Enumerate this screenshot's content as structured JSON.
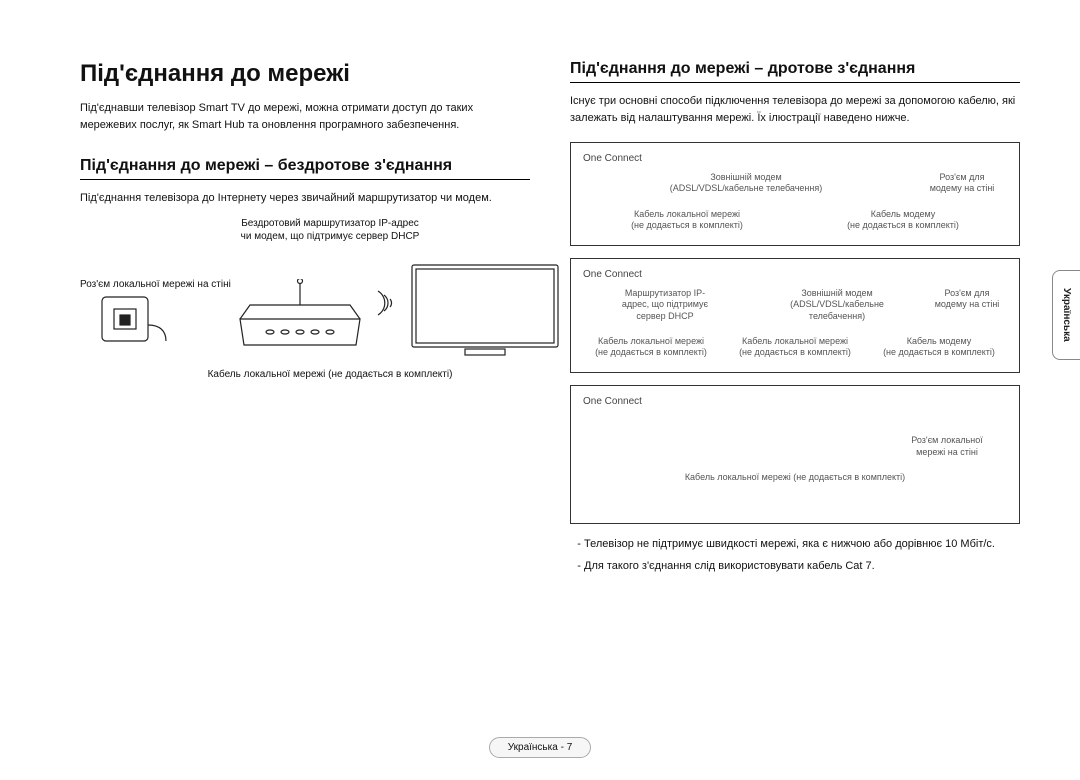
{
  "left": {
    "title": "Під'єднання до мережі",
    "intro": "Під'єднавши телевізор Smart TV до мережі, можна отримати доступ до таких мережевих послуг, як Smart Hub та оновлення програмного забезпечення.",
    "wireless_heading": "Під'єднання до мережі – бездротове з'єднання",
    "wireless_sub": "Під'єднання телевізора до Інтернету через звичайний маршрутизатор чи модем.",
    "router_caption_l1": "Бездротовий маршрутизатор IP-адрес",
    "router_caption_l2": "чи модем, що підтримує сервер DHCP",
    "wall_caption": "Роз'єм локальної мережі на стіні",
    "lan_caption": "Кабель локальної мережі (не додається в комплекті)"
  },
  "right": {
    "wired_heading": "Під'єднання до мережі – дротове з'єднання",
    "wired_sub": "Існує три основні способи підключення телевізора до мережі за допомогою кабелю, які залежать від налаштування мережі. Їх ілюстрації наведено нижче.",
    "box1": {
      "oc": "One Connect",
      "modem_l1": "Зовнішній модем",
      "modem_l2": "(ADSL/VDSL/кабельне телебачення)",
      "jack_l1": "Роз'єм для",
      "jack_l2": "модему на стіні",
      "lan_l1": "Кабель локальної мережі",
      "lan_l2": "(не додається в комплекті)",
      "mcable_l1": "Кабель модему",
      "mcable_l2": "(не додається в комплекті)"
    },
    "box2": {
      "oc": "One Connect",
      "router_l1": "Маршрутизатор IP-",
      "router_l2": "адрес, що підтримує",
      "router_l3": "сервер DHCP",
      "modem_l1": "Зовнішній модем",
      "modem_l2": "(ADSL/VDSL/кабельне",
      "modem_l3": "телебачення)",
      "jack_l1": "Роз'єм для",
      "jack_l2": "модему на стіні",
      "lan_a_l1": "Кабель локальної мережі",
      "lan_a_l2": "(не додається в комплекті)",
      "lan_b_l1": "Кабель локальної мережі",
      "lan_b_l2": "(не додається в комплекті)",
      "mcable_l1": "Кабель модему",
      "mcable_l2": "(не додається в комплекті)"
    },
    "box3": {
      "oc": "One Connect",
      "jack_l1": "Роз'єм локальної",
      "jack_l2": "мережі на стіні",
      "lan_l1": "Кабель локальної мережі (не додається в комплекті)"
    },
    "notes": {
      "n1": "Телевізор не підтримує швидкості мережі, яка є нижчою або дорівнює 10 Мбіт/с.",
      "n2": "Для такого з'єднання слід використовувати кабель Cat 7."
    }
  },
  "side_tab": "Українська",
  "footer": "Українська - 7"
}
